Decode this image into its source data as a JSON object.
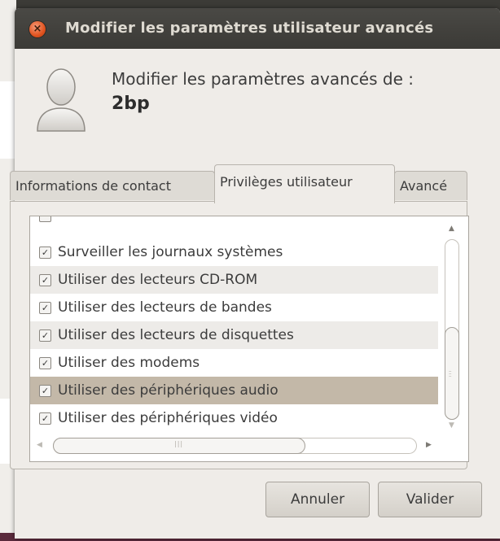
{
  "window": {
    "title": "Modifier les paramètres utilisateur avancés"
  },
  "header": {
    "heading": "Modifier les paramètres avancés de :",
    "username": "2bp"
  },
  "tabs": [
    {
      "label": "Informations de contact",
      "active": false
    },
    {
      "label": "Privilèges utilisateur",
      "active": true
    },
    {
      "label": "Avancé",
      "active": false
    }
  ],
  "privileges": [
    {
      "label": "Surveiller les journaux systèmes",
      "checked": true,
      "selected": false
    },
    {
      "label": "Utiliser des lecteurs CD-ROM",
      "checked": true,
      "selected": false
    },
    {
      "label": "Utiliser des lecteurs de bandes",
      "checked": true,
      "selected": false
    },
    {
      "label": "Utiliser des lecteurs de disquettes",
      "checked": true,
      "selected": false
    },
    {
      "label": "Utiliser des modems",
      "checked": true,
      "selected": false
    },
    {
      "label": "Utiliser des périphériques audio",
      "checked": true,
      "selected": true
    },
    {
      "label": "Utiliser des périphériques vidéo",
      "checked": true,
      "selected": false
    }
  ],
  "buttons": {
    "cancel": "Annuler",
    "ok": "Valider"
  },
  "colors": {
    "titlebar": "#3c3b37",
    "close_button": "#e0531f",
    "selection": "#c3b8a8",
    "window_bg": "#efece8"
  },
  "icons": {
    "close": "close-icon",
    "user": "user-avatar-icon",
    "check": "checkmark-icon"
  }
}
